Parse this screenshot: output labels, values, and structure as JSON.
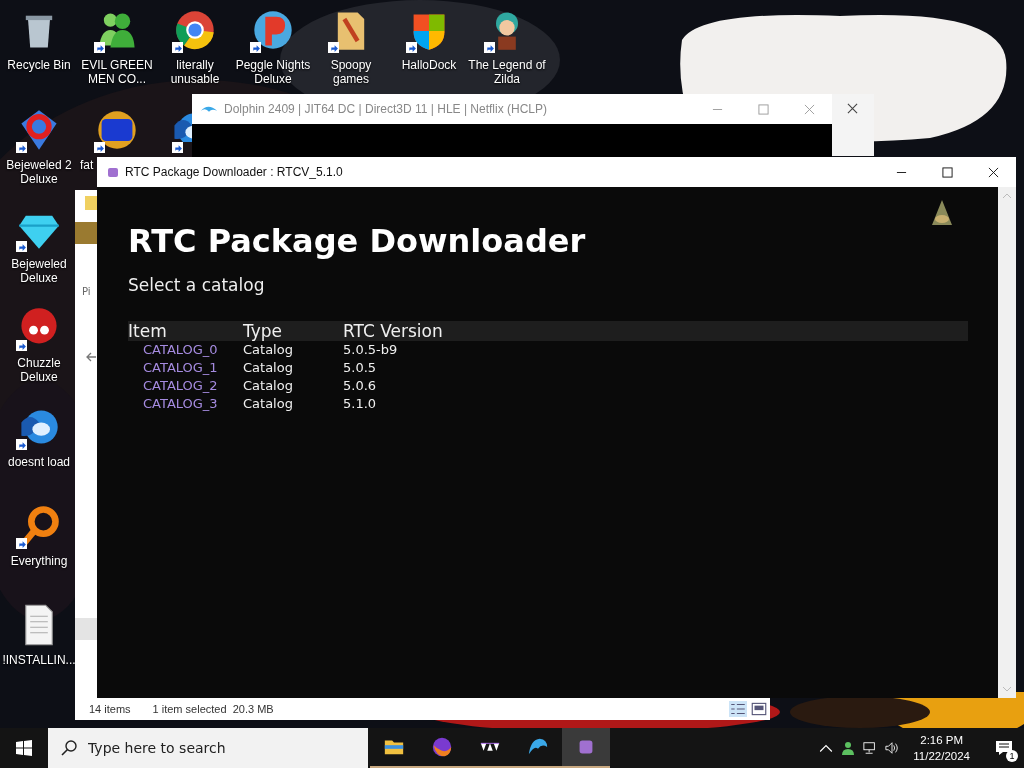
{
  "desktop_icons": [
    {
      "label": "Recycle Bin",
      "kind": "bin",
      "shortcut": false
    },
    {
      "label": "EVIL GREEN MEN CO...",
      "kind": "people",
      "shortcut": true
    },
    {
      "label": "literally unusable",
      "kind": "browser",
      "shortcut": true
    },
    {
      "label": "Peggle Nights Deluxe",
      "kind": "letter-ball",
      "shortcut": true
    },
    {
      "label": "Spoopy games",
      "kind": "folder",
      "shortcut": true
    },
    {
      "label": "HalloDock",
      "kind": "shield",
      "shortcut": true
    },
    {
      "label": "The Legend of Zilda",
      "kind": "character",
      "shortcut": true
    },
    {
      "label": "Bejeweled 2 Deluxe",
      "kind": "ring",
      "shortcut": true
    },
    {
      "label": "fat",
      "kind": "badge",
      "shortcut": true
    },
    {
      "kind": "bird",
      "shortcut": true
    },
    {
      "label": "Bejeweled Deluxe",
      "kind": "gem",
      "shortcut": true
    },
    {
      "label": "Chuzzle Deluxe",
      "kind": "fuzzball",
      "shortcut": true
    },
    {
      "label": "doesnt load",
      "kind": "bird",
      "shortcut": true
    },
    {
      "label": "Everything",
      "kind": "magnifier",
      "shortcut": true
    },
    {
      "label": "!INSTALLIN...",
      "kind": "document",
      "shortcut": false
    }
  ],
  "explorer_window": {
    "pin_label": "Pi",
    "status_items": [
      "14 items",
      "1 item selected  20.3 MB"
    ]
  },
  "dolphin_window": {
    "title": "Dolphin 2409 | JIT64 DC | Direct3D 11 | HLE | Netflix (HCLP)"
  },
  "rtc_window": {
    "title": "RTC Package Downloader : RTCV_5.1.0",
    "heading": "RTC Package Downloader",
    "subtitle": "Select a catalog",
    "table": {
      "columns": [
        "Item",
        "Type",
        "RTC Version"
      ],
      "rows": [
        [
          "CATALOG_0",
          "Catalog",
          "5.0.5-b9"
        ],
        [
          "CATALOG_1",
          "Catalog",
          "5.0.5"
        ],
        [
          "CATALOG_2",
          "Catalog",
          "5.0.6"
        ],
        [
          "CATALOG_3",
          "Catalog",
          "5.1.0"
        ]
      ]
    }
  },
  "taskbar": {
    "search": {
      "placeholder": "Type here to search"
    },
    "apps": [
      {
        "kind": "folder",
        "selected": false
      },
      {
        "kind": "fox",
        "selected": false
      },
      {
        "kind": "triangles",
        "selected": false
      },
      {
        "kind": "dolphin",
        "selected": false
      },
      {
        "kind": "cube",
        "selected": true
      }
    ],
    "time": "2:16 PM",
    "date": "11/22/2024",
    "notification_count": "1"
  }
}
